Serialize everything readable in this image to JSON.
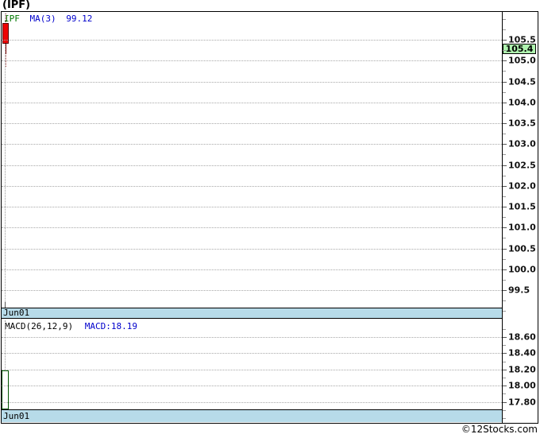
{
  "title": "(IPF)",
  "main_panel": {
    "legend": {
      "symbol": "IPF",
      "ma_label": "MA(3)",
      "ma_value": "99.12"
    },
    "date_label": "Jun01",
    "last_price_label": "105.4"
  },
  "macd_panel": {
    "indicator_label": "MACD(26,12,9)",
    "indicator_value": "MACD:18.19",
    "date_label": "Jun01"
  },
  "footer": {
    "brand": "©12Stocks.com"
  },
  "colors": {
    "candle_down_fill": "#ee0202",
    "candle_border": "#550000",
    "wick": "#7a0000",
    "macd_bar_outline": "#005500",
    "date_bar_bg": "#b7dbe9",
    "last_price_bg": "#aef3ae",
    "legend_symbol": "#007700",
    "legend_indicator": "#0000cc",
    "gridline": "#a8a8a8",
    "axis_tick_major": "#555555",
    "axis_tick_minor": "#999999"
  },
  "chart_data": [
    {
      "type": "candlestick",
      "title": "(IPF)",
      "legend": [
        "IPF",
        "MA(3)",
        "99.12"
      ],
      "x": [
        "Jun01"
      ],
      "series": [
        {
          "name": "IPF",
          "data": [
            {
              "x": "Jun01",
              "open": 105.9,
              "high": 105.9,
              "low": 105.15,
              "close": 105.4
            }
          ]
        }
      ],
      "indicators": [
        {
          "name": "MA(3)",
          "value": 99.12
        }
      ],
      "last_price": 105.4,
      "ylim": [
        99.0,
        106.2
      ],
      "ytick_labels": [
        "105.5",
        "105.0",
        "104.5",
        "104.0",
        "103.5",
        "103.0",
        "102.5",
        "102.0",
        "101.5",
        "101.0",
        "100.5",
        "100.0",
        "99.5"
      ],
      "grid": "dotted-horizontal",
      "legend_position": "top-left"
    },
    {
      "type": "bar",
      "title": "MACD(26,12,9)",
      "value_label": "MACD:18.19",
      "categories": [
        "Jun01"
      ],
      "values": [
        18.19
      ],
      "ylim": [
        17.6,
        18.7
      ],
      "ytick_labels": [
        "18.60",
        "18.40",
        "18.20",
        "18.00",
        "17.80"
      ],
      "bar_style": "hollow-outline",
      "grid": "dotted-horizontal"
    }
  ]
}
